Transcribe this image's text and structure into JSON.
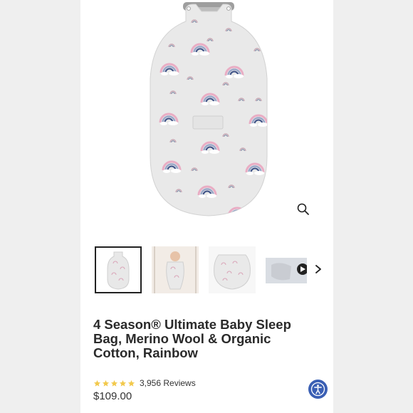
{
  "product": {
    "title": "4 Season® Ultimate Baby Sleep Bag, Merino Wool & Organic Cotton, Rainbow",
    "rating_stars": 5,
    "reviews_label": "3,956 Reviews",
    "price": "$109.00"
  },
  "gallery": {
    "zoom_icon": "magnifier-icon",
    "next_icon": "chevron-right-icon",
    "thumbnails": [
      {
        "name": "thumb-sleep-bag-front",
        "selected": true
      },
      {
        "name": "thumb-baby-in-crib",
        "selected": false
      },
      {
        "name": "thumb-sleep-bag-flat",
        "selected": false
      },
      {
        "name": "thumb-video",
        "selected": false
      }
    ]
  },
  "accessibility": {
    "icon": "accessibility-icon"
  },
  "colors": {
    "rating_star": "#f2c94c",
    "accessibility_button": "#3a5fb4",
    "rainbow_pink": "#e6a8bf",
    "rainbow_blue": "#7a8fb8"
  }
}
